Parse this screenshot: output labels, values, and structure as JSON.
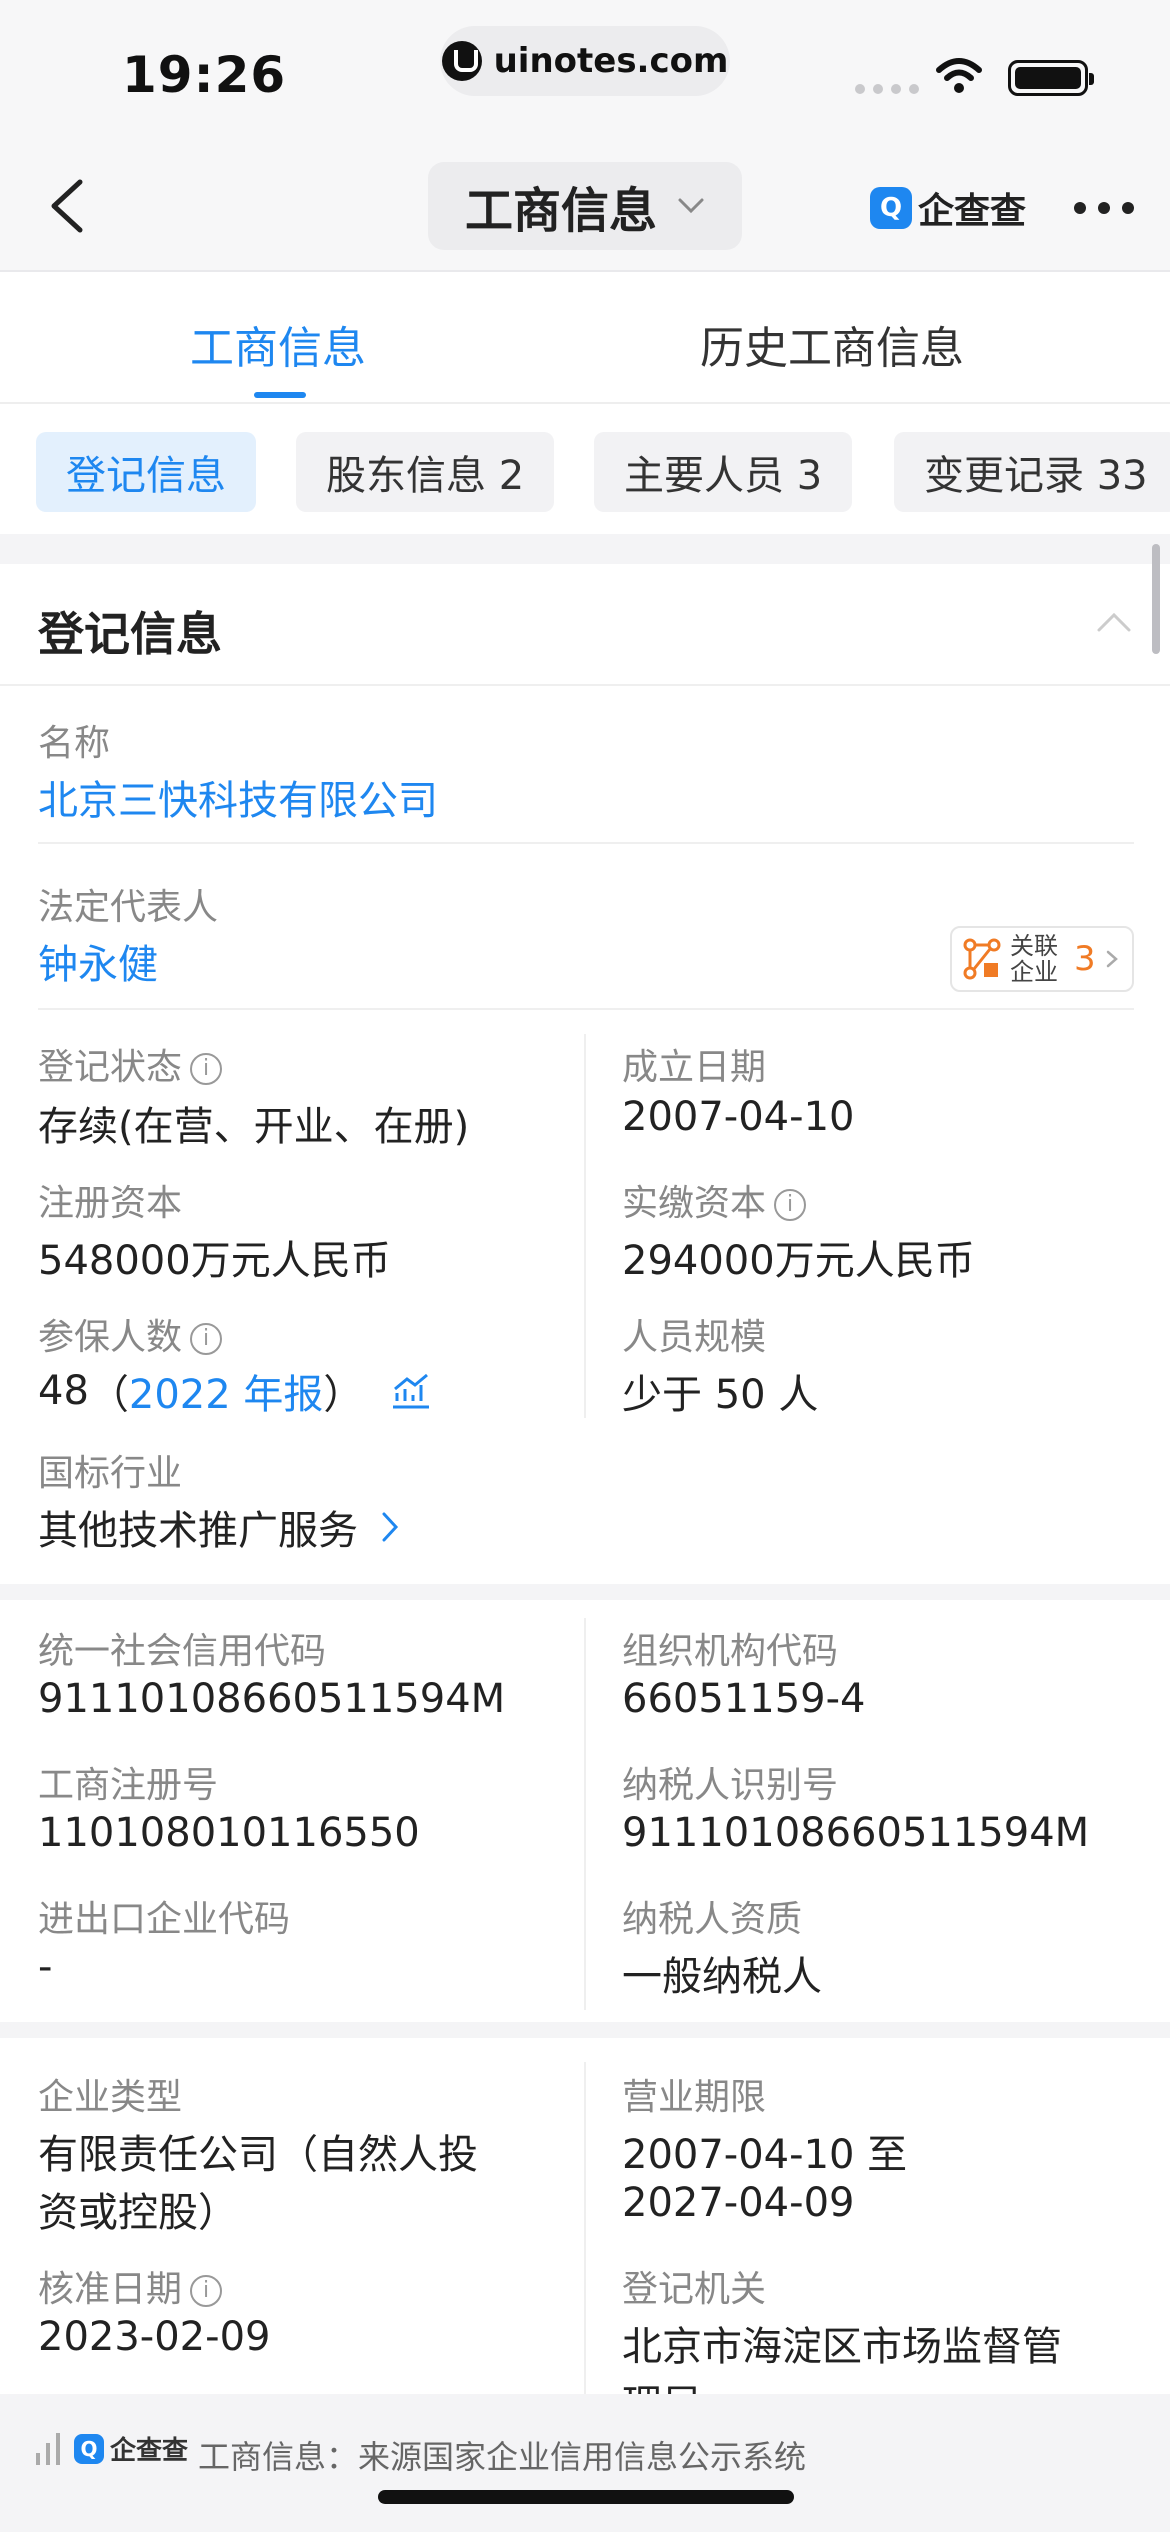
{
  "status_bar": {
    "time": "19:26",
    "url": "uinotes.com"
  },
  "nav": {
    "title": "工商信息",
    "brand": "企查查"
  },
  "tabs": [
    {
      "label": "工商信息",
      "active": true
    },
    {
      "label": "历史工商信息",
      "active": false
    }
  ],
  "chips": [
    {
      "label": "登记信息",
      "active": true
    },
    {
      "label": "股东信息 2",
      "active": false
    },
    {
      "label": "主要人员 3",
      "active": false
    },
    {
      "label": "变更记录 33",
      "active": false
    }
  ],
  "section": {
    "title": "登记信息",
    "name": {
      "label": "名称",
      "value": "北京三快科技有限公司"
    },
    "legal_rep": {
      "label": "法定代表人",
      "value": "钟永健",
      "related_label": "关联企业",
      "related_count": "3"
    },
    "status": {
      "label": "登记状态",
      "value": "存续(在营、开业、在册)"
    },
    "founded": {
      "label": "成立日期",
      "value": "2007-04-10"
    },
    "reg_capital": {
      "label": "注册资本",
      "value": "548000万元人民币"
    },
    "paid_capital": {
      "label": "实缴资本",
      "value": "294000万元人民币"
    },
    "insured": {
      "label": "参保人数",
      "count": "48",
      "paren_open": "（",
      "report_link": "2022 年报",
      "paren_close": "）"
    },
    "staff_size": {
      "label": "人员规模",
      "value": "少于 50 人"
    },
    "industry": {
      "label": "国标行业",
      "value": "其他技术推广服务"
    },
    "credit_code": {
      "label": "统一社会信用代码",
      "value": "91110108660511594M"
    },
    "org_code": {
      "label": "组织机构代码",
      "value": "66051159-4"
    },
    "biz_reg_no": {
      "label": "工商注册号",
      "value": "110108010116550"
    },
    "taxpayer_id": {
      "label": "纳税人识别号",
      "value": "91110108660511594M"
    },
    "import_export": {
      "label": "进出口企业代码",
      "value": "-"
    },
    "taxpayer_type": {
      "label": "纳税人资质",
      "value": "一般纳税人"
    },
    "company_type": {
      "label": "企业类型",
      "value_line1": "有限责任公司（自然人投",
      "value_line2": "资或控股）"
    },
    "biz_term": {
      "label": "营业期限",
      "value_line1": "2007-04-10 至",
      "value_line2": "2027-04-09"
    },
    "approval_date": {
      "label": "核准日期",
      "value": "2023-02-09"
    },
    "reg_authority": {
      "label": "登记机关",
      "value_line1": "北京市海淀区市场监督管",
      "value_line2": "理局"
    }
  },
  "footer": {
    "brand": "企查查",
    "source": "工商信息：来源国家企业信用信息公示系统"
  },
  "colors": {
    "accent": "#1e87f0",
    "related_count": "#f07b25"
  }
}
